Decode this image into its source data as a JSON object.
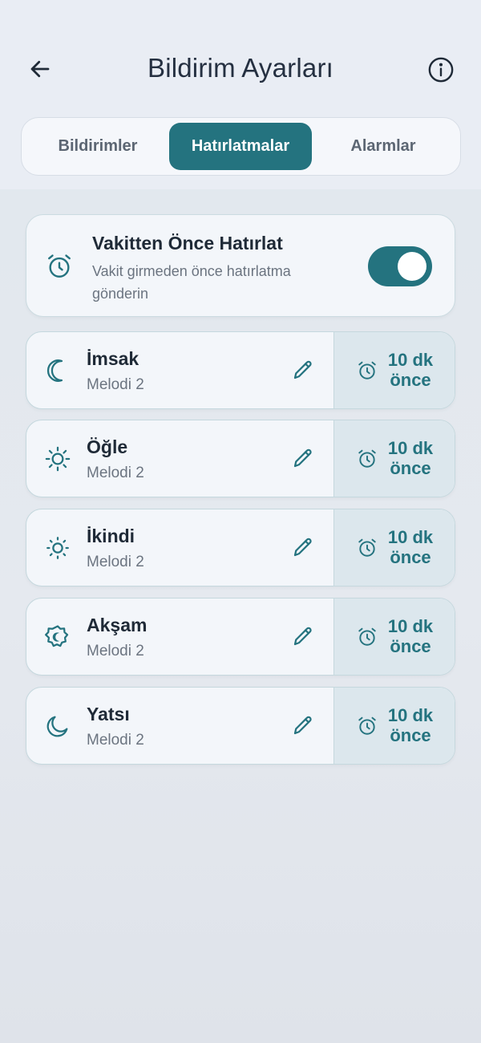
{
  "header": {
    "title": "Bildirim Ayarları"
  },
  "tabs": [
    {
      "label": "Bildirimler"
    },
    {
      "label": "Hatırlatmalar"
    },
    {
      "label": "Alarmlar"
    }
  ],
  "reminder": {
    "title": "Vakitten Önce Hatırlat",
    "description": "Vakit girmeden önce hatırlatma gönderin",
    "enabled": true
  },
  "prayers": [
    {
      "name": "İmsak",
      "melody": "Melodi 2",
      "offset": "10 dk önce",
      "icon": "moon-crescent-icon"
    },
    {
      "name": "Öğle",
      "melody": "Melodi 2",
      "offset": "10 dk önce",
      "icon": "sun-icon"
    },
    {
      "name": "İkindi",
      "melody": "Melodi 2",
      "offset": "10 dk önce",
      "icon": "sun-small-icon"
    },
    {
      "name": "Akşam",
      "melody": "Melodi 2",
      "offset": "10 dk önce",
      "icon": "sunset-moon-badge-icon"
    },
    {
      "name": "Yatsı",
      "melody": "Melodi 2",
      "offset": "10 dk önce",
      "icon": "moon-icon"
    }
  ],
  "colors": {
    "accent": "#24737f",
    "offset_bg": "#dce7ed",
    "card_bg": "#f3f6fa"
  }
}
